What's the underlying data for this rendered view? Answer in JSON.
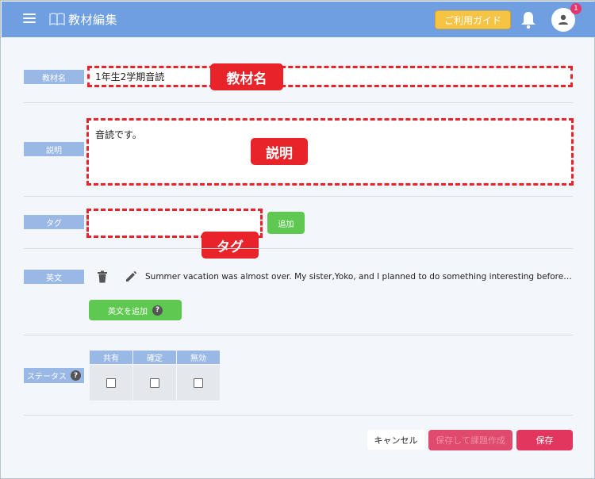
{
  "header": {
    "title": "教材編集",
    "guide_label": "ご利用ガイド",
    "notification_count": "1",
    "brand_color": "#6f9fe0"
  },
  "form": {
    "name": {
      "label": "教材名",
      "value": "1年生2学期音読",
      "annotation": "教材名"
    },
    "description": {
      "label": "説明",
      "value": "音読です。",
      "annotation": "説明"
    },
    "tag": {
      "label": "タグ",
      "value": "",
      "add_label": "追加",
      "annotation": "タグ"
    },
    "english": {
      "label": "英文",
      "items": [
        {
          "text": "Summer vacation was almost over. My sister,Yoko, and I planned to do something interesting before school starte..."
        }
      ],
      "add_label": "英文を追加"
    },
    "status": {
      "label": "ステータス",
      "columns": [
        "共有",
        "確定",
        "無効"
      ],
      "checked": [
        false,
        false,
        false
      ]
    }
  },
  "footer": {
    "cancel_label": "キャンセル",
    "save_and_create_label": "保存して課題作成",
    "save_label": "保存"
  },
  "icons": {
    "menu": "menu-icon",
    "book": "book-icon",
    "bell": "bell-icon",
    "user": "user-icon",
    "trash": "trash-icon",
    "pencil": "pencil-icon",
    "help": "help-icon"
  }
}
